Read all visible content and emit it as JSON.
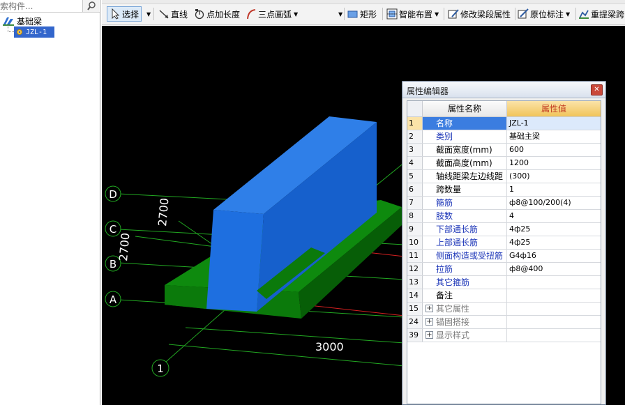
{
  "left_panel": {
    "search_placeholder": "索构件...",
    "tree": {
      "root_label": "基础梁",
      "child_label": "JZL-1"
    }
  },
  "toolbar": {
    "select_label": "选择",
    "line_label": "直线",
    "point_length_label": "点加长度",
    "three_arc_label": "三点画弧",
    "rect_label": "矩形",
    "smart_layout_label": "智能布置",
    "modify_span_label": "修改梁段属性",
    "in_place_label": "原位标注",
    "reextract_label": "重提梁跨"
  },
  "canvas": {
    "axis_labels": [
      "D",
      "C",
      "B",
      "A",
      "1"
    ],
    "dimensions": [
      "2700",
      "2700",
      "3000"
    ],
    "colors": {
      "beam": "#1e6fe0",
      "footing": "#0a7a0a",
      "grid_line": "#22a822",
      "red_line": "#d42020",
      "background": "#000000"
    }
  },
  "properties": {
    "title": "属性编辑器",
    "header_name": "属性名称",
    "header_value": "属性值",
    "rows": [
      {
        "num": "1",
        "name": "名称",
        "value": "JZL-1",
        "style": "sel"
      },
      {
        "num": "2",
        "name": "类别",
        "value": "基础主梁",
        "style": "blue"
      },
      {
        "num": "3",
        "name": "截面宽度(mm)",
        "value": "600",
        "style": "black"
      },
      {
        "num": "4",
        "name": "截面高度(mm)",
        "value": "1200",
        "style": "black"
      },
      {
        "num": "5",
        "name": "轴线距梁左边线距",
        "value": "(300)",
        "style": "black"
      },
      {
        "num": "6",
        "name": "跨数量",
        "value": "1",
        "style": "black"
      },
      {
        "num": "7",
        "name": "箍筋",
        "value": "ф8@100/200(4)",
        "style": "blue"
      },
      {
        "num": "8",
        "name": "肢数",
        "value": "4",
        "style": "blue"
      },
      {
        "num": "9",
        "name": "下部通长筋",
        "value": "4ф25",
        "style": "blue"
      },
      {
        "num": "10",
        "name": "上部通长筋",
        "value": "4ф25",
        "style": "blue"
      },
      {
        "num": "11",
        "name": "侧面构造或受扭筋",
        "value": "G4ф16",
        "style": "blue"
      },
      {
        "num": "12",
        "name": "拉筋",
        "value": "ф8@400",
        "style": "blue"
      },
      {
        "num": "13",
        "name": "其它箍筋",
        "value": "",
        "style": "blue"
      },
      {
        "num": "14",
        "name": "备注",
        "value": "",
        "style": "black"
      },
      {
        "num": "15",
        "name": "其它属性",
        "value": "",
        "style": "gray",
        "group": true
      },
      {
        "num": "24",
        "name": "锚固搭接",
        "value": "",
        "style": "gray",
        "group": true
      },
      {
        "num": "39",
        "name": "显示样式",
        "value": "",
        "style": "gray",
        "group": true
      }
    ]
  }
}
